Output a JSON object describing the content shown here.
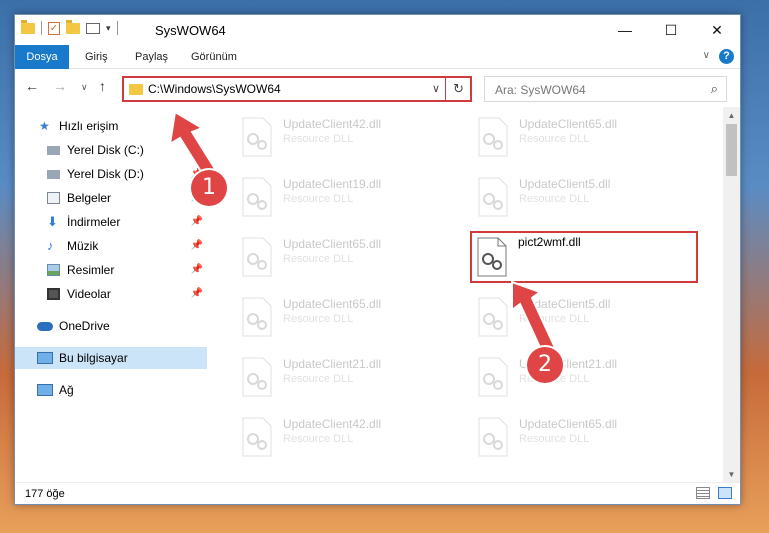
{
  "window": {
    "title": "SysWOW64",
    "controls": [
      "—",
      "☐",
      "✕"
    ]
  },
  "ribbon": {
    "tabs": [
      {
        "label": "Dosya"
      },
      {
        "label": "Giriş"
      },
      {
        "label": "Paylaş"
      },
      {
        "label": "Görünüm"
      }
    ],
    "chevron": "∨",
    "help": "?"
  },
  "navbar": {
    "back": "←",
    "forward": "→",
    "recent": "∨",
    "up": "↑",
    "address": "C:\\Windows\\SysWOW64",
    "address_dropdown": "∨",
    "refresh": "↻",
    "search_placeholder": "Ara: SysWOW64",
    "search_icon": "⌕"
  },
  "sidebar": {
    "items": [
      {
        "label": "Hızlı erişim",
        "icon": "star-icon",
        "pinned": false
      },
      {
        "label": "Yerel Disk (C:)",
        "icon": "drive-icon",
        "pinned": true
      },
      {
        "label": "Yerel Disk (D:)",
        "icon": "drive-icon",
        "pinned": true
      },
      {
        "label": "Belgeler",
        "icon": "document-icon",
        "pinned": true
      },
      {
        "label": "İndirmeler",
        "icon": "download-icon",
        "pinned": true
      },
      {
        "label": "Müzik",
        "icon": "music-icon",
        "pinned": true
      },
      {
        "label": "Resimler",
        "icon": "picture-icon",
        "pinned": true
      },
      {
        "label": "Videolar",
        "icon": "video-icon",
        "pinned": true
      },
      {
        "label": "OneDrive",
        "icon": "cloud-icon",
        "pinned": false
      },
      {
        "label": "Bu bilgisayar",
        "icon": "computer-icon",
        "pinned": false
      },
      {
        "label": "Ağ",
        "icon": "network-icon",
        "pinned": false
      }
    ],
    "pin_glyph": "📌"
  },
  "files": {
    "left_column": [
      {
        "name": "UpdateClient42.dll",
        "type": "Resource DLL"
      },
      {
        "name": "UpdateClient19.dll",
        "type": "Resource DLL"
      },
      {
        "name": "UpdateClient65.dll",
        "type": "Resource DLL"
      },
      {
        "name": "UpdateClient65.dll",
        "type": "Resource DLL"
      },
      {
        "name": "UpdateClient21.dll",
        "type": "Resource DLL"
      },
      {
        "name": "UpdateClient42.dll",
        "type": "Resource DLL"
      }
    ],
    "right_column": [
      {
        "name": "UpdateClient65.dll",
        "type": "Resource DLL"
      },
      {
        "name": "UpdateClient5.dll",
        "type": "Resource DLL"
      },
      {
        "name": "pict2wmf.dll",
        "type": ""
      },
      {
        "name": "UpdateClient5.dll",
        "type": "Resource DLL"
      },
      {
        "name": "UpdateClient21.dll",
        "type": "Resource DLL"
      },
      {
        "name": "UpdateClient65.dll",
        "type": "Resource DLL"
      }
    ]
  },
  "statusbar": {
    "count": "177 öğe"
  },
  "annotations": {
    "marker_1": "1",
    "marker_2": "2",
    "color": "#e04545"
  },
  "colors": {
    "accent": "#1979ca",
    "highlight_border": "#d03a3a",
    "selected_bg": "#cce4f7"
  }
}
